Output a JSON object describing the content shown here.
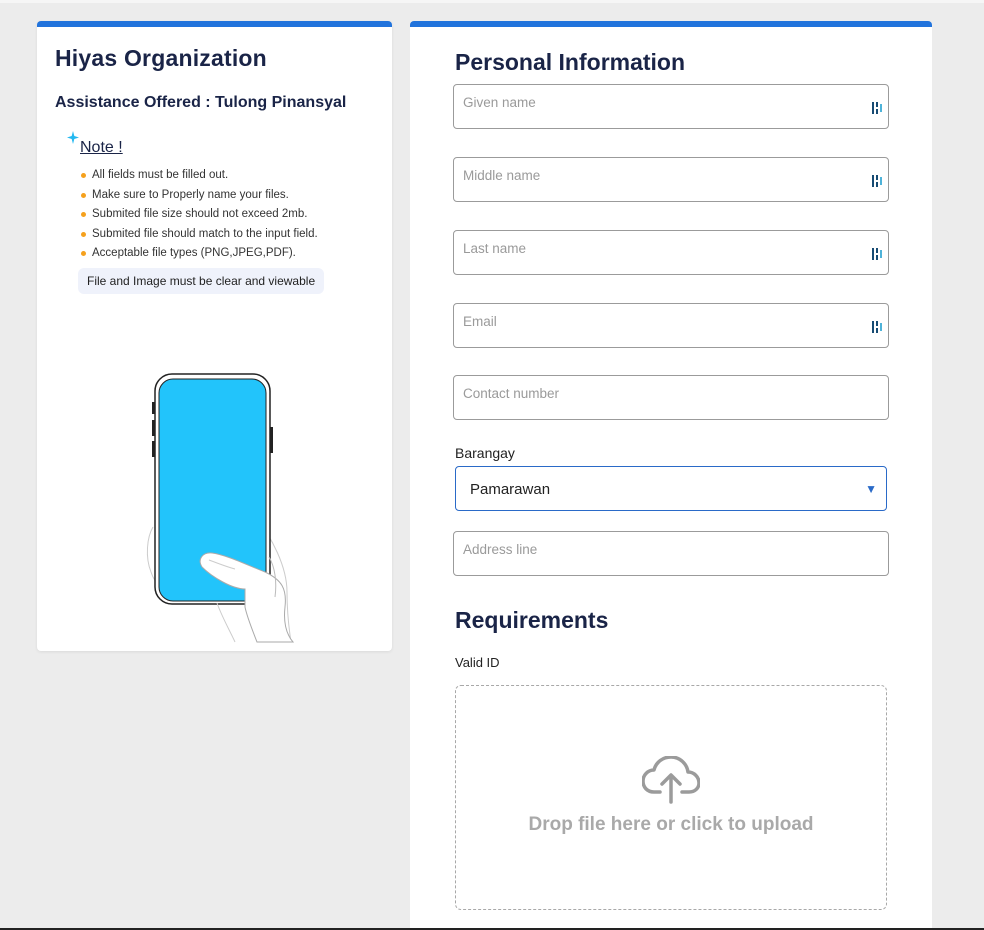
{
  "organization": {
    "title": "Hiyas Organization",
    "assistance": "Assistance Offered : Tulong Pinansyal"
  },
  "note": {
    "title": "Note !",
    "items": [
      "All fields must be filled out.",
      "Make sure to Properly name your files.",
      "Submited file size should not exceed 2mb.",
      "Submited file should match to the input field.",
      "Acceptable file types (PNG,JPEG,PDF)."
    ],
    "clear_text": "File and Image must be clear and viewable"
  },
  "personal": {
    "title": "Personal Information",
    "given_name_placeholder": "Given name",
    "middle_name_placeholder": "Middle name",
    "last_name_placeholder": "Last name",
    "email_placeholder": "Email",
    "contact_placeholder": "Contact number",
    "barangay_label": "Barangay",
    "barangay_value": "Pamarawan",
    "address_placeholder": "Address line"
  },
  "requirements": {
    "title": "Requirements",
    "valid_id_label": "Valid ID",
    "drop_text": "Drop file here or click to upload"
  },
  "colors": {
    "accent": "#2173dc",
    "phone_screen": "#22c4fb",
    "bullet": "#f5a11d"
  },
  "icons": [
    "sparkle-icon",
    "autofill-icon",
    "chevron-down-icon",
    "cloud-upload-icon"
  ]
}
